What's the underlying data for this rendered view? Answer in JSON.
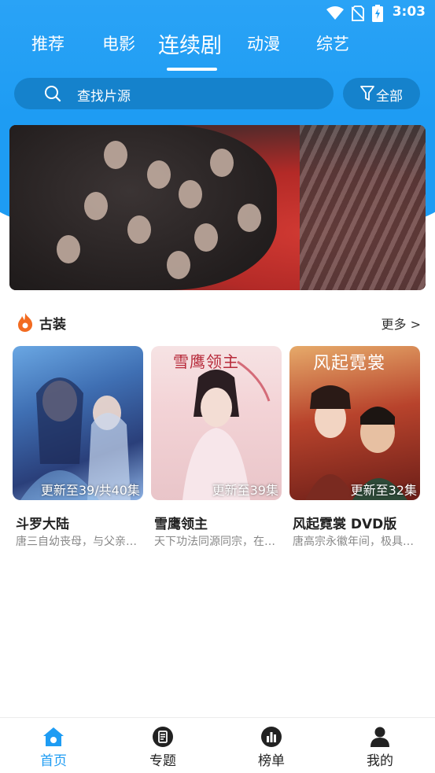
{
  "status_bar": {
    "time": "3:03"
  },
  "tabs": [
    {
      "label": "推荐"
    },
    {
      "label": "电影"
    },
    {
      "label": "连续剧"
    },
    {
      "label": "动漫"
    },
    {
      "label": "综艺"
    }
  ],
  "active_tab_index": 2,
  "search": {
    "placeholder": "查找片源"
  },
  "filter": {
    "label": "全部"
  },
  "section": {
    "title": "古装",
    "more_label": "更多 >"
  },
  "cards": [
    {
      "title": "斗罗大陆",
      "caption": "更新至39/共40集",
      "description": "唐三自幼丧母，与父亲…"
    },
    {
      "title": "雪鹰领主",
      "caption": "更新至39集",
      "description": "天下功法同源同宗，在…"
    },
    {
      "title": "风起霓裳 DVD版",
      "caption": "更新至32集",
      "description": "唐高宗永徽年间，极具…"
    }
  ],
  "poster_texts": [
    {
      "text": "雪鹰领主"
    },
    {
      "text": "风起霓裳"
    }
  ],
  "bottom_nav": [
    {
      "label": "首页",
      "icon": "home-icon",
      "active": true
    },
    {
      "label": "专题",
      "icon": "topics-icon",
      "active": false
    },
    {
      "label": "榜单",
      "icon": "ranking-icon",
      "active": false
    },
    {
      "label": "我的",
      "icon": "profile-icon",
      "active": false
    }
  ],
  "colors": {
    "primary": "#1e9cf3",
    "search_bg": "#1582cc",
    "section_icon": "#f26b21"
  }
}
